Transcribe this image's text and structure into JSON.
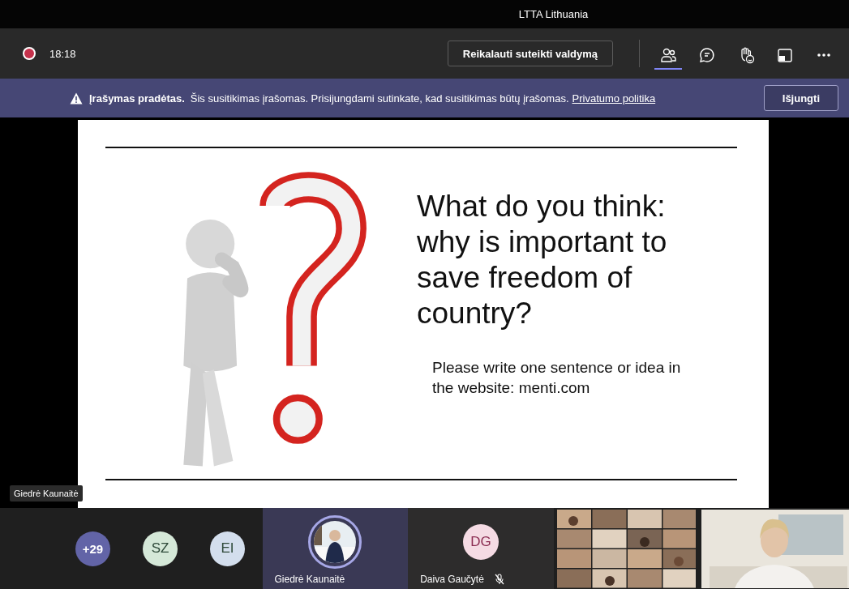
{
  "window": {
    "title": "LTTA Lithuania"
  },
  "toolbar": {
    "recording": true,
    "time": "18:18",
    "control_button": "Reikalauti suteikti valdymą",
    "buttons": [
      {
        "kind": "participants",
        "selected": true
      },
      {
        "kind": "chat",
        "selected": false
      },
      {
        "kind": "reactions",
        "selected": false
      },
      {
        "kind": "share",
        "selected": false
      },
      {
        "kind": "more",
        "selected": false
      }
    ]
  },
  "banner": {
    "title": "Įrašymas pradėtas.",
    "message": "Šis susitikimas įrašomas. Prisijungdami sutinkate, kad susitikimas būtų įrašomas.",
    "link": "Privatumo politika",
    "button": "Išjungti"
  },
  "stage": {
    "slide": {
      "heading": "What do you think: why is important to save freedom of country?",
      "body": "Please write one sentence or idea in the website: menti.com"
    },
    "presenter": "Giedrė Kaunaitė"
  },
  "participants": [
    {
      "kind": "overflow",
      "label": "+29",
      "color": "#6264a7"
    },
    {
      "kind": "initials",
      "label": "SZ",
      "color": "#d5e8d8"
    },
    {
      "kind": "initials",
      "label": "EI",
      "color": "#d3deed"
    },
    {
      "name": "Giedrė Kaunaitė",
      "speaking": true
    },
    {
      "kind": "initials",
      "label": "DG",
      "name": "Daiva Gaučytė",
      "muted": true,
      "color": "#f5dbe4"
    },
    {
      "kind": "video_grid"
    },
    {
      "kind": "video"
    }
  ]
}
